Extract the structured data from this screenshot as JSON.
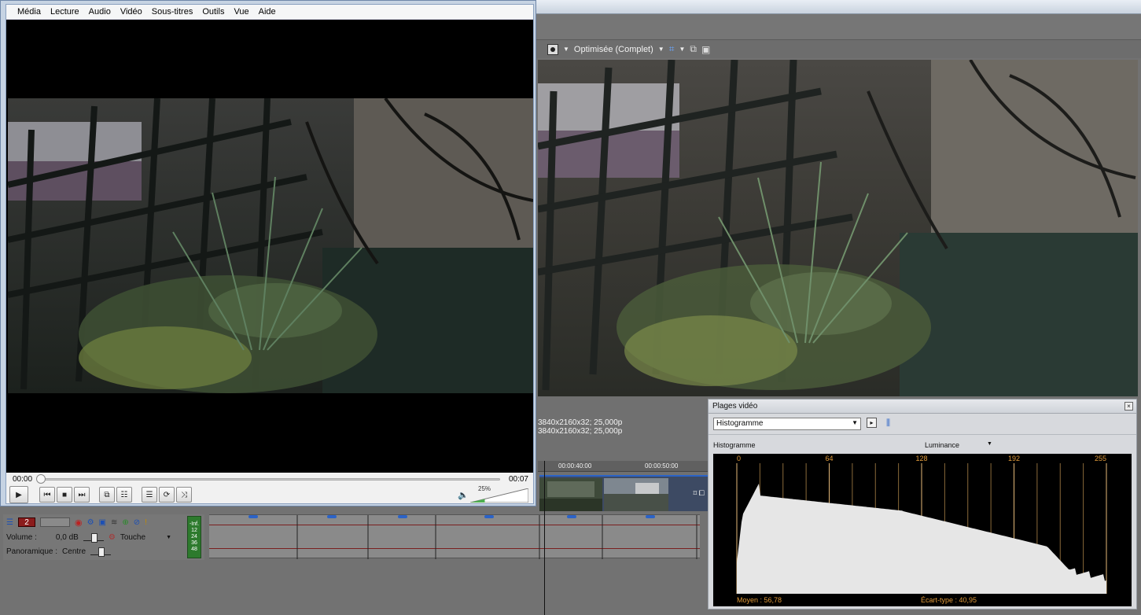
{
  "player": {
    "menu": [
      "Média",
      "Lecture",
      "Audio",
      "Vidéo",
      "Sous-titres",
      "Outils",
      "Vue",
      "Aide"
    ],
    "time_elapsed": "00:00",
    "time_total": "00:07",
    "volume_percent": "25%",
    "volume_level": 0.25
  },
  "preview": {
    "quality_label": "Optimisée (Complet)",
    "media_info_line1": "3840x2160x32; 25,000p",
    "media_info_line2": "3840x2160x32; 25,000p"
  },
  "timeline": {
    "ruler_marks": [
      "00:00:40:00",
      "00:00:50:00"
    ]
  },
  "audio_track": {
    "track_number": "2",
    "volume_label": "Volume :",
    "volume_value": "0,0 dB",
    "touch_mode": "Touche",
    "pan_label": "Panoramique :",
    "pan_value": "Centre",
    "meter_ticks": [
      "-Inf.",
      "12",
      "24",
      "36",
      "48"
    ]
  },
  "scopes": {
    "panel_title": "Plages vidéo",
    "scope_type": "Histogramme",
    "sub_label": "Histogramme",
    "channel": "Luminance",
    "axis_ticks": [
      "0",
      "64",
      "128",
      "192",
      "255"
    ],
    "mean_text": "Moyen : 56,78",
    "stddev_text": "Écart-type : 40,95"
  },
  "icons": {
    "play": "play-icon",
    "prev": "previous-icon",
    "stop": "stop-icon",
    "next": "next-icon",
    "fullscreen": "fullscreen-icon",
    "settings": "equalizer-icon",
    "playlist": "playlist-icon",
    "loop": "loop-icon",
    "shuffle": "shuffle-icon",
    "speaker": "speaker-icon"
  }
}
